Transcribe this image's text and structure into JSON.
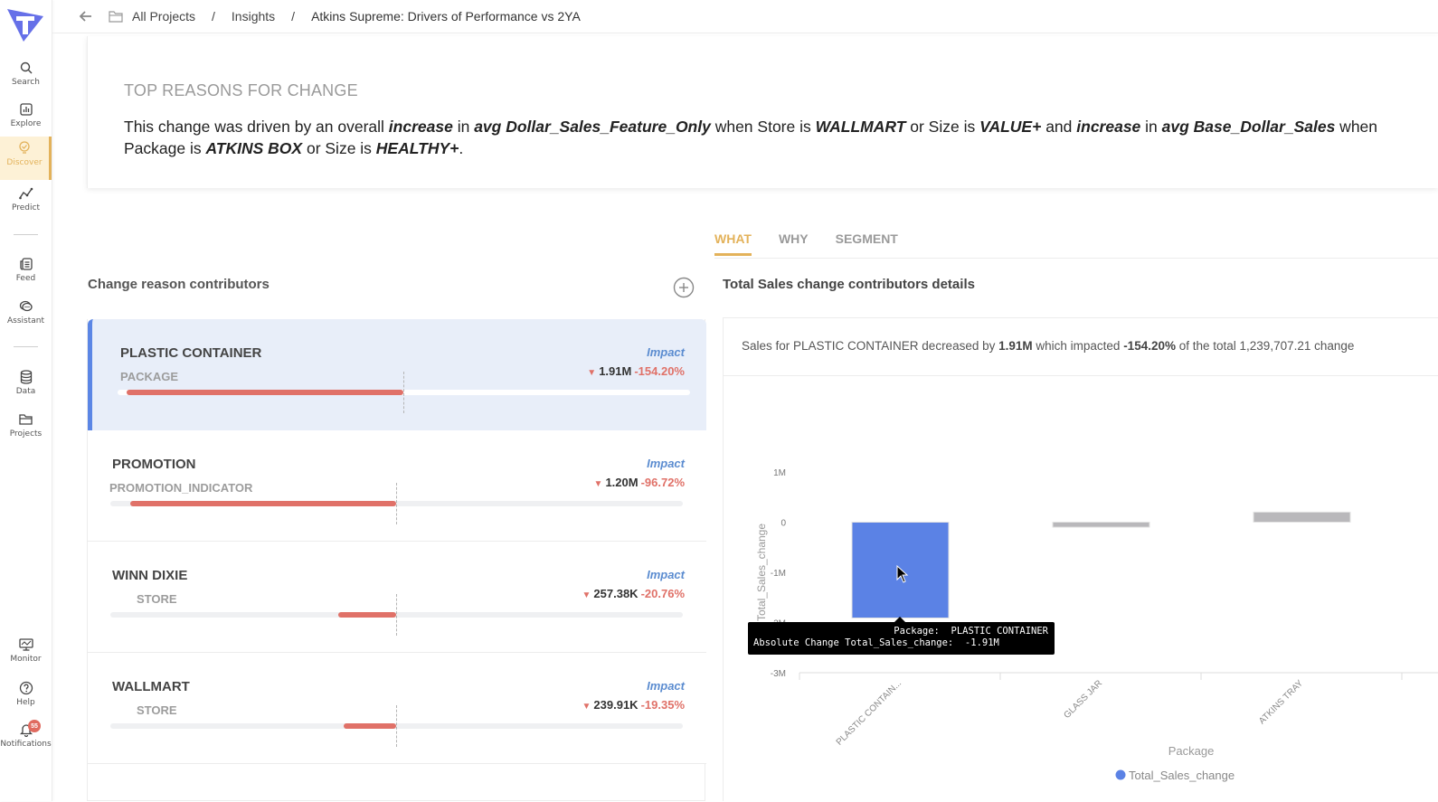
{
  "nav": {
    "items": [
      {
        "id": "search",
        "label": "Search"
      },
      {
        "id": "explore",
        "label": "Explore"
      },
      {
        "id": "discover",
        "label": "Discover",
        "active": true
      },
      {
        "id": "predict",
        "label": "Predict"
      },
      {
        "id": "feed",
        "label": "Feed"
      },
      {
        "id": "assistant",
        "label": "Assistant"
      },
      {
        "id": "data",
        "label": "Data"
      },
      {
        "id": "projects",
        "label": "Projects"
      },
      {
        "id": "monitor",
        "label": "Monitor"
      },
      {
        "id": "help",
        "label": "Help"
      },
      {
        "id": "notifications",
        "label": "Notifications"
      }
    ],
    "notification_count": "55"
  },
  "breadcrumb": {
    "items": [
      "All Projects",
      "Insights",
      "Atkins Supreme: Drivers of Performance vs 2YA"
    ],
    "separator": "/"
  },
  "reasons": {
    "title": "TOP REASONS FOR CHANGE",
    "parts": [
      {
        "t": "This change was driven by an overall "
      },
      {
        "t": "increase",
        "em": true
      },
      {
        "t": " in "
      },
      {
        "t": "avg Dollar_Sales_Feature_Only",
        "em": true
      },
      {
        "t": " when Store is "
      },
      {
        "t": "WALLMART",
        "em": true
      },
      {
        "t": " or Size is "
      },
      {
        "t": "VALUE+",
        "em": true
      },
      {
        "t": " and "
      },
      {
        "t": "increase",
        "em": true
      },
      {
        "t": " in "
      },
      {
        "t": "avg Base_Dollar_Sales",
        "em": true
      },
      {
        "t": " when Package is "
      },
      {
        "t": "ATKINS BOX",
        "em": true
      },
      {
        "t": " or Size is "
      },
      {
        "t": "HEALTHY+",
        "em": true
      },
      {
        "t": "."
      }
    ]
  },
  "tabs": [
    {
      "label": "WHAT",
      "active": true
    },
    {
      "label": "WHY"
    },
    {
      "label": "SEGMENT"
    }
  ],
  "contributors": {
    "title": "Change reason contributors",
    "impact_label": "Impact",
    "items": [
      {
        "name": "PLASTIC CONTAINER",
        "dimension": "PACKAGE",
        "value": "1.91M",
        "pct": "-154.20%",
        "direction": "down",
        "bar_fraction": -1.0,
        "selected": true
      },
      {
        "name": "PROMOTION",
        "dimension": "PROMOTION_INDICATOR",
        "value": "1.20M",
        "pct": "-96.72%",
        "direction": "down",
        "bar_fraction": -0.96
      },
      {
        "name": "WINN DIXIE",
        "dimension": "STORE",
        "value": "257.38K",
        "pct": "-20.76%",
        "direction": "down",
        "bar_fraction": -0.21
      },
      {
        "name": "WALLMART",
        "dimension": "STORE",
        "value": "239.91K",
        "pct": "-19.35%",
        "direction": "down",
        "bar_fraction": -0.19
      }
    ]
  },
  "details": {
    "title": "Total Sales change contributors details",
    "summary": {
      "p1": "Sales for PLASTIC CONTAINER decreased by ",
      "v1": "1.91M",
      "p2": " which impacted ",
      "v2": "-154.20%",
      "p3": " of the total 1,239,707.21 change"
    },
    "tooltip": {
      "line1_label": "Package:",
      "line1_value": "PLASTIC CONTAINER",
      "line2_label": "Absolute Change Total_Sales_change:",
      "line2_value": "-1.91M"
    }
  },
  "chart_data": {
    "type": "bar",
    "title": "",
    "xlabel": "Package",
    "ylabel": "Total_Sales_change",
    "categories": [
      "PLASTIC CONTAIN...",
      "GLASS JAR",
      "ATKINS TRAY"
    ],
    "series": [
      {
        "name": "Total_Sales_change",
        "values": [
          -1.91,
          -0.1,
          0.2
        ],
        "unit": "M"
      }
    ],
    "highlight_index": 0,
    "colors": {
      "highlight": "#5b82e5",
      "other": "#b9b8bb"
    },
    "yticks": [
      "1M",
      "0",
      "-1M",
      "-2M",
      "-3M"
    ],
    "ylim": [
      -3,
      1
    ],
    "legend": "bottom",
    "grid": false
  }
}
